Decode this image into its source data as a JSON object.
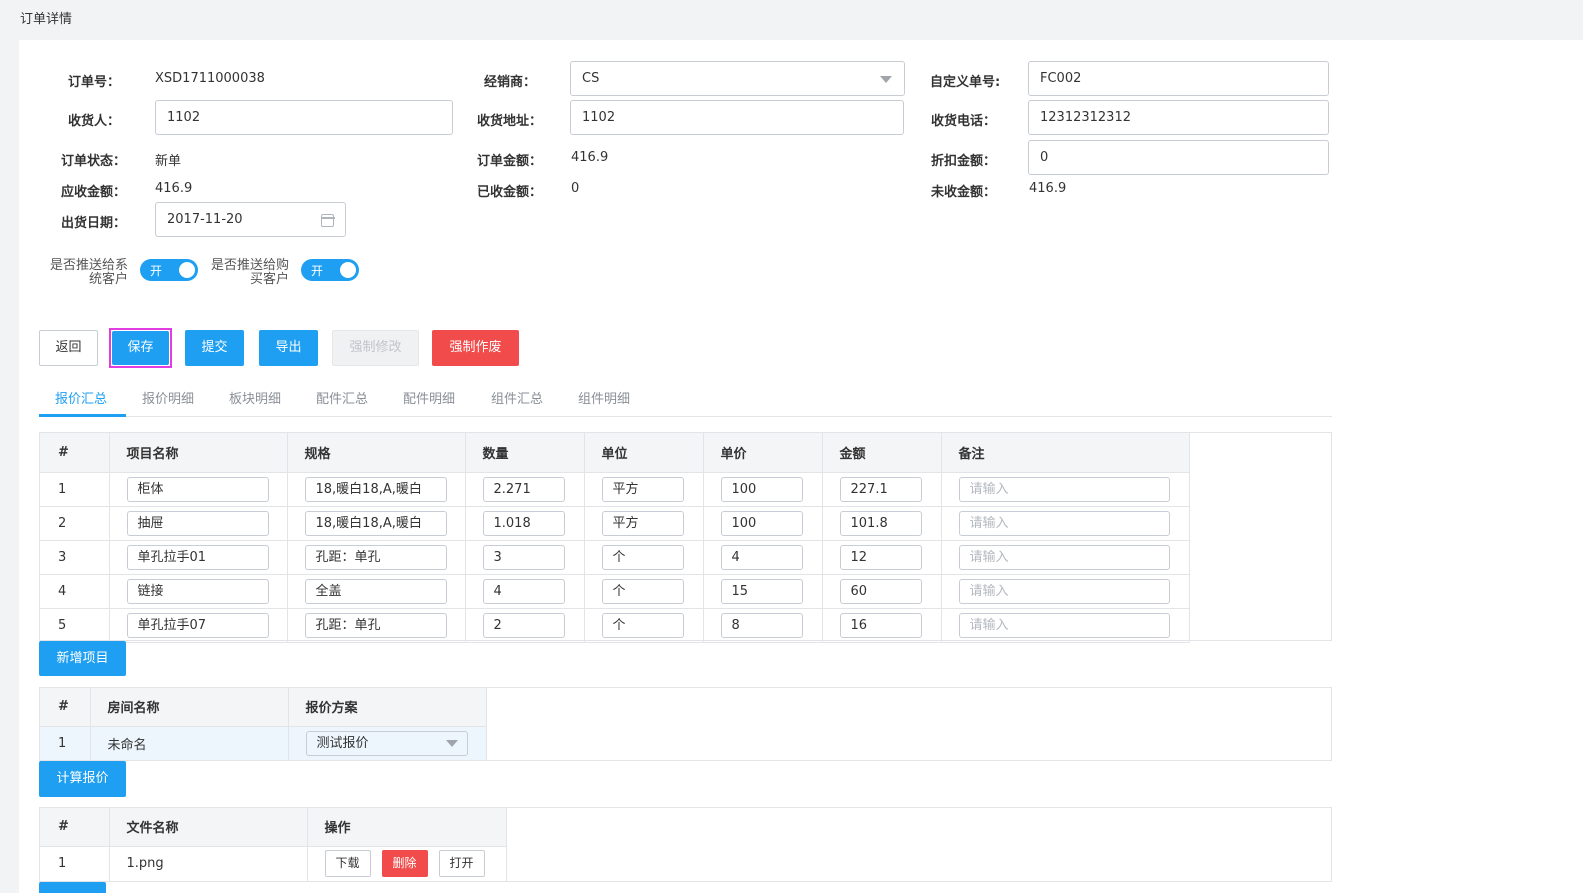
{
  "page_title": "订单详情",
  "form": {
    "order_no_label": "订单号：",
    "order_no": "XSD1711000038",
    "dealer_label": "经销商：",
    "dealer": "CS",
    "custom_no_label": "自定义单号:",
    "custom_no": "FC002",
    "receiver_label": "收货人：",
    "receiver": "1102",
    "address_label": "收货地址：",
    "address": "1102",
    "phone_label": "收货电话：",
    "phone": "12312312312",
    "status_label": "订单状态：",
    "status": "新单",
    "amount_label": "订单金额：",
    "amount": "416.9",
    "discount_label": "折扣金额：",
    "discount": "0",
    "receivable_label": "应收金额：",
    "receivable": "416.9",
    "received_label": "已收金额：",
    "received": "0",
    "unreceived_label": "未收金额：",
    "unreceived": "416.9",
    "ship_date_label": "出货日期：",
    "ship_date": "2017-11-20"
  },
  "switches": {
    "push_system_label_1": "是否推送给系",
    "push_system_label_2": "统客户",
    "push_system_state": "开",
    "push_buyer_label_1": "是否推送给购",
    "push_buyer_label_2": "买客户",
    "push_buyer_state": "开"
  },
  "toolbar": {
    "back": "返回",
    "save": "保存",
    "submit": "提交",
    "export": "导出",
    "force_edit": "强制修改",
    "force_void": "强制作废"
  },
  "tabs": [
    "报价汇总",
    "报价明细",
    "板块明细",
    "配件汇总",
    "配件明细",
    "组件汇总",
    "组件明细"
  ],
  "items_table": {
    "headers": [
      "#",
      "项目名称",
      "规格",
      "数量",
      "单位",
      "单价",
      "金额",
      "备注"
    ],
    "placeholder": "请输入",
    "rows": [
      [
        "1",
        "柜体",
        "18,暖白18,A,暖白",
        "2.271",
        "平方",
        "100",
        "227.1"
      ],
      [
        "2",
        "抽屉",
        "18,暖白18,A,暖白",
        "1.018",
        "平方",
        "100",
        "101.8"
      ],
      [
        "3",
        "单孔拉手01",
        "孔距：单孔",
        "3",
        "个",
        "4",
        "12"
      ],
      [
        "4",
        "链接",
        "全盖",
        "4",
        "个",
        "15",
        "60"
      ],
      [
        "5",
        "单孔拉手07",
        "孔距：单孔",
        "2",
        "个",
        "8",
        "16"
      ]
    ],
    "add_button": "新增项目"
  },
  "rooms_table": {
    "headers": [
      "#",
      "房间名称",
      "报价方案"
    ],
    "rows": [
      [
        "1",
        "未命名",
        "测试报价"
      ]
    ],
    "calc_button": "计算报价"
  },
  "files_table": {
    "headers": [
      "#",
      "文件名称",
      "操作"
    ],
    "rows": [
      [
        "1",
        "1.png"
      ]
    ],
    "download": "下载",
    "delete": "删除",
    "open": "打开"
  }
}
